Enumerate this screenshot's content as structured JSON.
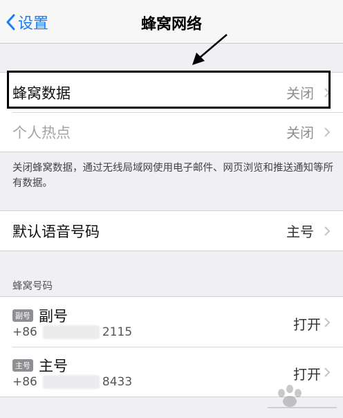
{
  "navbar": {
    "back_label": "设置",
    "title": "蜂窝网络"
  },
  "rows_group1": [
    {
      "label": "蜂窝数据",
      "value": "关闭"
    },
    {
      "label": "个人热点",
      "value": "关闭"
    }
  ],
  "footnote": "关闭蜂窝数据，通过无线局域网使用电子邮件、网页浏览和推送通知等所有数据。",
  "voice": {
    "label": "默认语音号码",
    "value": "主号"
  },
  "sims_header": "蜂窝号码",
  "sims": [
    {
      "badge": "副号",
      "name": "副号",
      "prefix": "+86",
      "suffix": "2115",
      "value": "打开"
    },
    {
      "badge": "主号",
      "name": "主号",
      "prefix": "+86",
      "suffix": "8433",
      "value": "打开"
    }
  ],
  "colors": {
    "accent": "#1a7cf5",
    "background": "#efeff4"
  }
}
